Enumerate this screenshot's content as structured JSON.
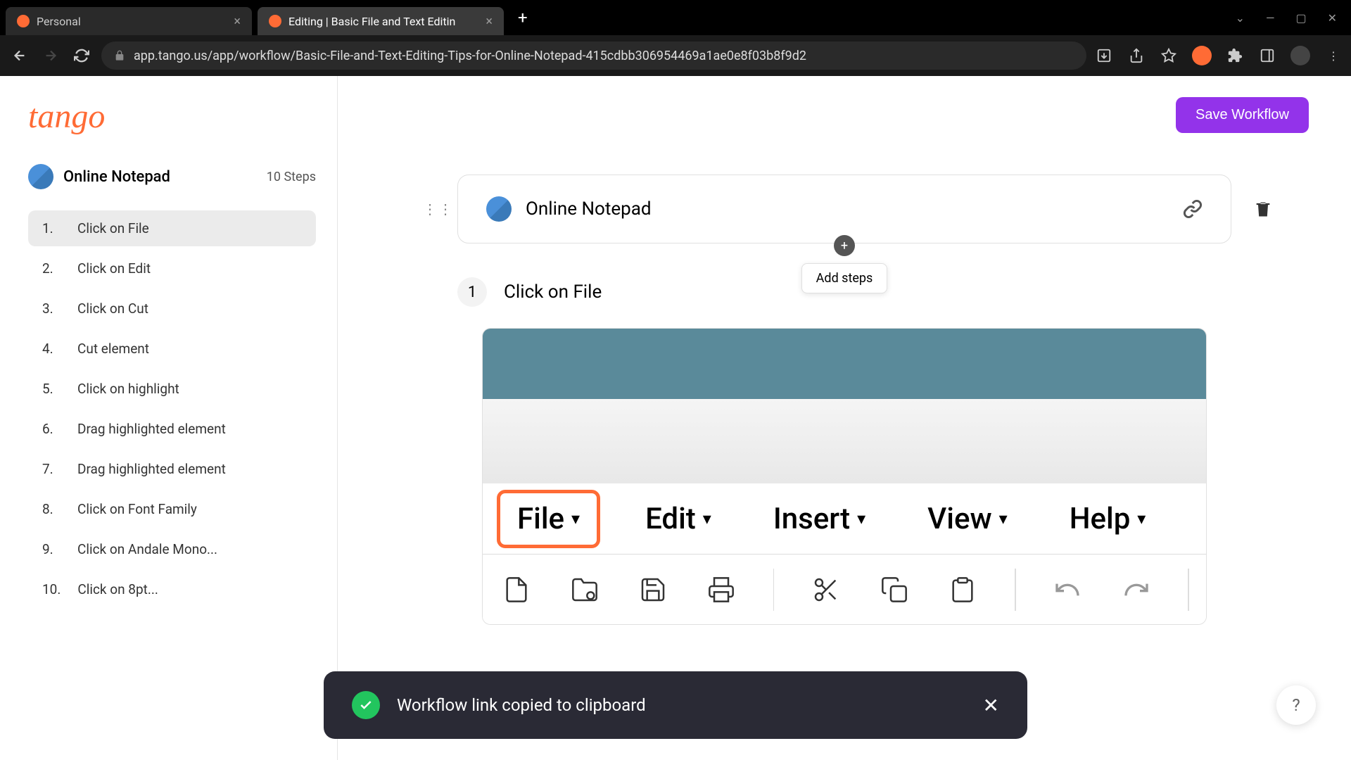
{
  "browser": {
    "tabs": [
      {
        "title": "Personal",
        "active": false
      },
      {
        "title": "Editing | Basic File and Text Editin",
        "active": true
      }
    ],
    "url": "app.tango.us/app/workflow/Basic-File-and-Text-Editing-Tips-for-Online-Notepad-415cdbb306954469a1ae0e8f03b8f9d2"
  },
  "app": {
    "logo": "tango",
    "save_button": "Save Workflow",
    "workflow": {
      "title": "Online Notepad",
      "step_count": "10 Steps"
    },
    "steps": [
      {
        "num": "1.",
        "label": "Click on File"
      },
      {
        "num": "2.",
        "label": "Click on Edit"
      },
      {
        "num": "3.",
        "label": "Click on Cut"
      },
      {
        "num": "4.",
        "label": "Cut element"
      },
      {
        "num": "5.",
        "label": "Click on highlight"
      },
      {
        "num": "6.",
        "label": "Drag highlighted element"
      },
      {
        "num": "7.",
        "label": "Drag highlighted element"
      },
      {
        "num": "8.",
        "label": "Click on Font Family"
      },
      {
        "num": "9.",
        "label": "Click on  Andale Mono..."
      },
      {
        "num": "10.",
        "label": "Click on  8pt..."
      }
    ],
    "card": {
      "title": "Online Notepad"
    },
    "add_steps_label": "Add steps",
    "current_step": {
      "num": "1",
      "title": "Click on File"
    },
    "screenshot_menus": {
      "file": "File",
      "edit": "Edit",
      "insert": "Insert",
      "view": "View",
      "help": "Help"
    }
  },
  "toast": {
    "message": "Workflow link copied to clipboard"
  },
  "help": "?"
}
